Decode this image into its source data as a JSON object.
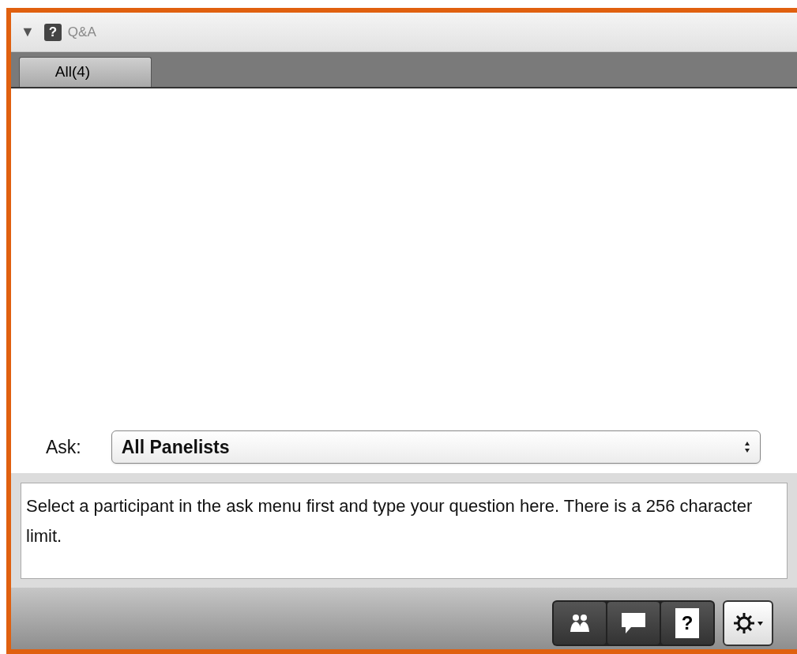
{
  "panel": {
    "collapse_glyph": "▼",
    "help_glyph": "?",
    "title": "Q&A"
  },
  "tabs": [
    {
      "label": "All(4)",
      "selected": true
    }
  ],
  "ask": {
    "label": "Ask:",
    "value": "All Panelists"
  },
  "question_field": {
    "placeholder": "Select a participant in the ask menu first and type your question here. There is a 256 character limit."
  },
  "toolbar": [
    {
      "kind": "participants"
    },
    {
      "kind": "chat"
    },
    {
      "kind": "help",
      "glyph": "?"
    },
    {
      "kind": "settings"
    }
  ]
}
